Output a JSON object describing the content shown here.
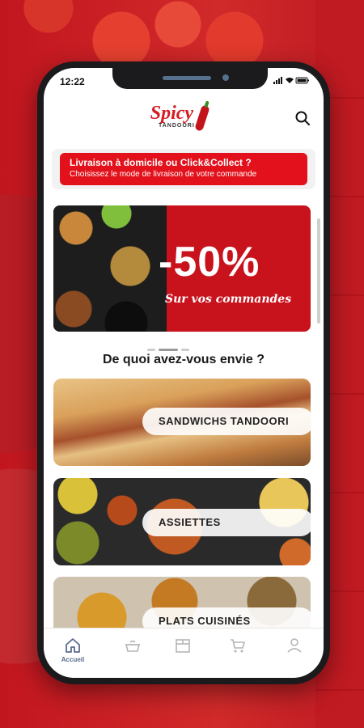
{
  "status": {
    "time": "12:22",
    "time_icon": "location-arrow-icon"
  },
  "header": {
    "logo_name": "Spicy",
    "logo_sub": "TANDOORI"
  },
  "delivery": {
    "title": "Livraison à domicile ou Click&Collect ?",
    "subtitle": "Choisissez le mode de livraison de votre commande"
  },
  "promo": {
    "percent": "-50%",
    "text": "Sur vos commandes"
  },
  "section": {
    "title": "De quoi avez-vous envie ?"
  },
  "categories": [
    {
      "label": "SANDWICHS TANDOORI"
    },
    {
      "label": "ASSIETTES"
    },
    {
      "label": "PLATS CUISINÉS"
    }
  ],
  "tabs": [
    {
      "icon": "home-icon",
      "label": "Accueil"
    },
    {
      "icon": "pot-icon",
      "label": ""
    },
    {
      "icon": "store-icon",
      "label": ""
    },
    {
      "icon": "cart-icon",
      "label": ""
    },
    {
      "icon": "user-icon",
      "label": ""
    }
  ],
  "colors": {
    "brand": "#e2111b",
    "tab_active": "#5a6b8c"
  }
}
